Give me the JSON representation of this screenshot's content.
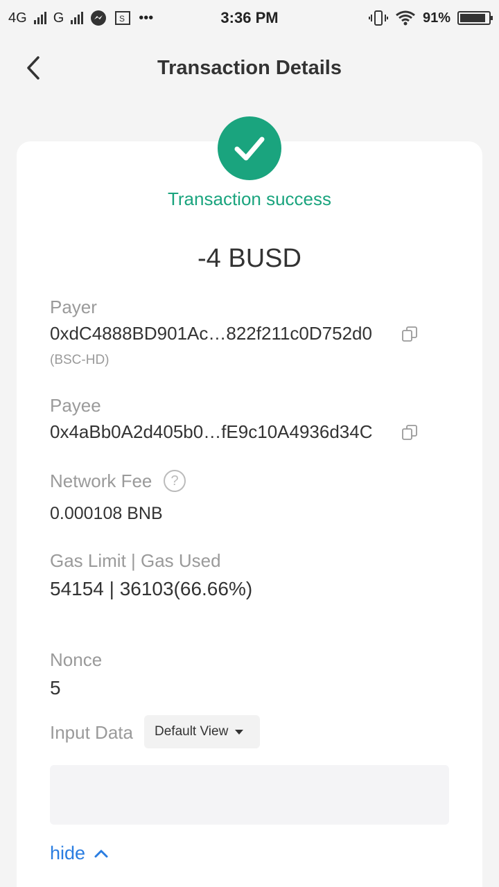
{
  "status_bar": {
    "network_1": "4G",
    "network_2": "G",
    "time": "3:36 PM",
    "more": "•••",
    "battery": "91%",
    "battery_level": 0.91
  },
  "header": {
    "title": "Transaction Details"
  },
  "transaction": {
    "status": "Transaction success",
    "status_color": "#1aa47e",
    "amount": "-4 BUSD",
    "payer_label": "Payer",
    "payer_address": "0xdC4888BD901Ac…822f211c0D752d0",
    "payer_wallet": "(BSC-HD)",
    "payee_label": "Payee",
    "payee_address": "0x4aBb0A2d405b0…fE9c10A4936d34C",
    "fee_label": "Network Fee",
    "fee_value": "0.000108 BNB",
    "gas_label": "Gas Limit | Gas Used",
    "gas_value": "54154 | 36103(66.66%)",
    "nonce_label": "Nonce",
    "nonce_value": "5",
    "input_label": "Input Data",
    "input_view": "Default View",
    "hide_label": "hide"
  },
  "icons": {
    "back": "chevron-left-icon",
    "success": "check-circle-icon",
    "copy": "copy-icon",
    "help": "question-circle-icon",
    "hide": "chevron-up-icon"
  },
  "colors": {
    "accent": "#1aa47e",
    "link": "#2a7de1"
  }
}
